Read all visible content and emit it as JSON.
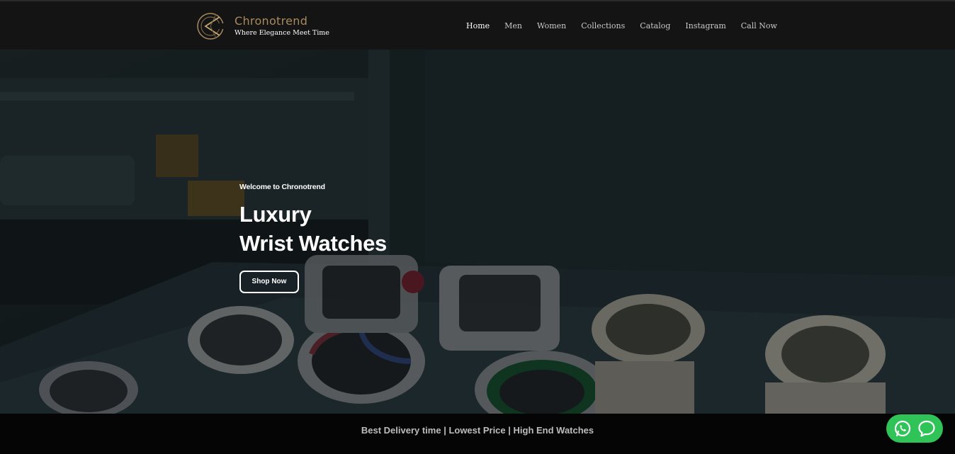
{
  "brand": {
    "name": "Chronotrend",
    "tagline": "Where Elegance Meet Time",
    "logo_icon": "chronotrend-c-logo-icon",
    "name_color": "#a88a5e"
  },
  "nav": {
    "items": [
      {
        "label": "Home",
        "active": true
      },
      {
        "label": "Men",
        "active": false
      },
      {
        "label": "Women",
        "active": false
      },
      {
        "label": "Collections",
        "active": false
      },
      {
        "label": "Catalog",
        "active": false
      },
      {
        "label": "Instagram",
        "active": false
      },
      {
        "label": "Call Now",
        "active": false
      }
    ]
  },
  "hero": {
    "kicker": "Welcome to Chronotrend",
    "title_line1": "Luxury",
    "title_line2": "Wrist Watches",
    "cta_label": "Shop Now",
    "background": "watches-in-case-photo"
  },
  "strip": {
    "text": "Best Delivery time | Lowest Price  | High End Watches"
  },
  "chat": {
    "whatsapp_icon": "whatsapp-icon",
    "message_icon": "chat-bubble-icon",
    "color": "#2fc358"
  }
}
